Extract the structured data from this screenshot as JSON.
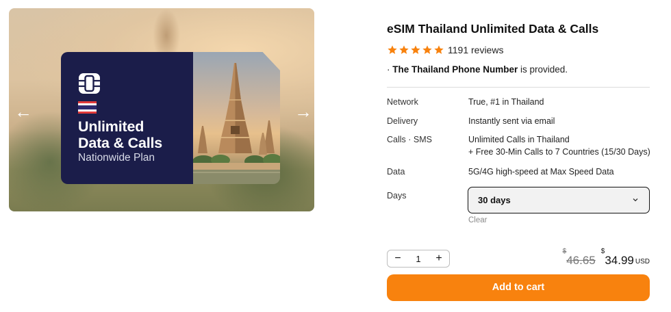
{
  "gallery": {
    "prev_arrow": "←",
    "next_arrow": "→",
    "card": {
      "title_line1": "Unlimited",
      "title_line2": "Data & Calls",
      "subtitle": "Nationwide Plan",
      "chip_icon": "sim-chip-icon",
      "flag_icon": "thailand-flag-icon"
    }
  },
  "product": {
    "title": "eSIM Thailand Unlimited Data & Calls",
    "rating": 5,
    "reviews": "1191 reviews",
    "note_prefix": "· ",
    "note_bold": "The Thailand Phone Number",
    "note_rest": " is provided."
  },
  "specs": {
    "network": {
      "label": "Network",
      "value": "True, #1 in Thailand"
    },
    "delivery": {
      "label": "Delivery",
      "value": "Instantly sent via email"
    },
    "calls": {
      "label": "Calls · SMS",
      "value": "Unlimited Calls in Thailand",
      "value2": "+ Free 30-Min Calls to 7 Countries (15/30 Days)"
    },
    "data": {
      "label": "Data",
      "value": "5G/4G high-speed at Max Speed Data"
    },
    "days": {
      "label": "Days",
      "selected": "30 days",
      "clear": "Clear"
    }
  },
  "purchase": {
    "minus": "−",
    "quantity": "1",
    "plus": "+",
    "currency_symbol": "$",
    "old_price": "46.65",
    "new_price": "34.99",
    "currency_code": "USD",
    "add_to_cart": "Add to cart"
  },
  "colors": {
    "accent": "#f8820e",
    "card_navy": "#1b1d4a",
    "star": "#f8820e"
  }
}
